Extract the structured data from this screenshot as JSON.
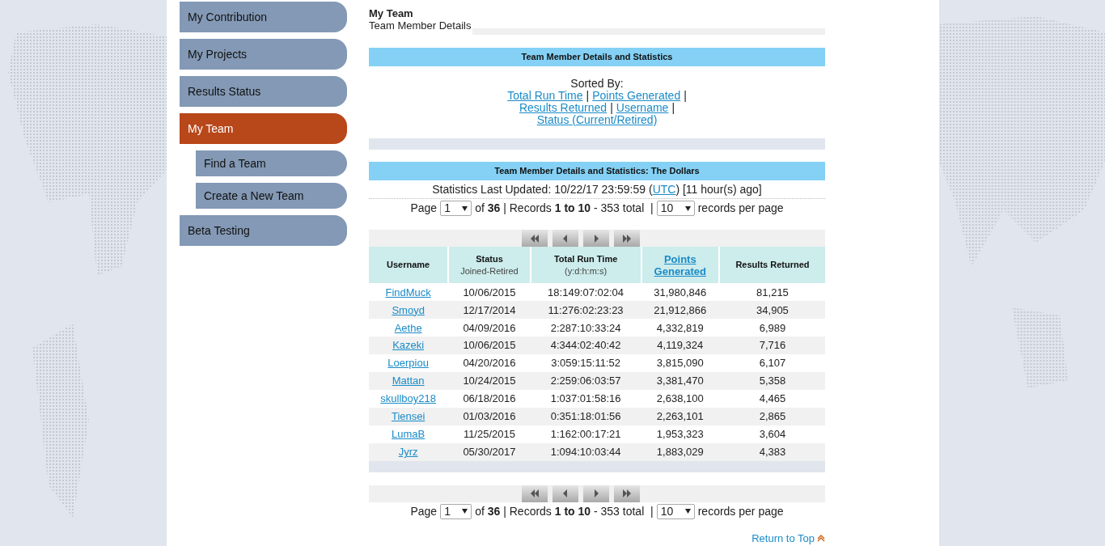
{
  "sidebar": {
    "items": [
      {
        "label": "My Contribution",
        "kind": "main",
        "selected": false
      },
      {
        "label": "My Projects",
        "kind": "main",
        "selected": false
      },
      {
        "label": "Results Status",
        "kind": "main",
        "selected": false
      },
      {
        "label": "My Team",
        "kind": "main",
        "selected": true
      },
      {
        "label": "Find a Team",
        "kind": "sub",
        "selected": false
      },
      {
        "label": "Create a New Team",
        "kind": "sub",
        "selected": false
      },
      {
        "label": "Beta Testing",
        "kind": "main",
        "selected": false
      }
    ]
  },
  "page": {
    "title": "My Team",
    "subtitle": "Team Member Details"
  },
  "sort_panel": {
    "title": "Team Member Details and Statistics",
    "label": "Sorted By:",
    "separator": "|",
    "links": [
      "Total Run Time",
      "Points Generated",
      "Results Returned",
      "Username",
      "Status (Current/Retired)"
    ]
  },
  "stats_panel": {
    "title": "Team Member Details and Statistics: The Dollars",
    "updated_prefix": "Statistics Last Updated: 10/22/17 23:59:59 (",
    "updated_link": "UTC",
    "updated_suffix": ") [11 hour(s) ago]"
  },
  "pagers": [
    {
      "page_label": "Page",
      "page_value": "1",
      "summary": "of **36** | Records **1 to 10** - 353 total  |",
      "per_page_value": "10",
      "per_page_label": "records per page"
    },
    {
      "page_label": "Page",
      "page_value": "1",
      "summary": "of **36** | Records **1 to 10** - 353 total  |",
      "per_page_value": "10",
      "per_page_label": "records per page"
    }
  ],
  "table": {
    "columns": [
      {
        "title": "Username",
        "kind": "link",
        "sortable": false
      },
      {
        "title": "Status",
        "subtitle": "Joined-Retired",
        "kind": "text",
        "sortable": false
      },
      {
        "title": "Total Run Time",
        "subtitle": "(y:d:h:m:s)",
        "kind": "text",
        "sortable": false
      },
      {
        "title": "Points Generated",
        "kind": "text",
        "sortable": true
      },
      {
        "title": "Results Returned",
        "kind": "text",
        "sortable": false
      }
    ],
    "rows": [
      [
        "FindMuck",
        "10/06/2015",
        "18:149:07:02:04",
        "31,980,846",
        "81,215"
      ],
      [
        "Smoyd",
        "12/17/2014",
        "11:276:02:23:23",
        "21,912,866",
        "34,905"
      ],
      [
        "Aethe",
        "04/09/2016",
        "2:287:10:33:24",
        "4,332,819",
        "6,989"
      ],
      [
        "Kazeki",
        "10/06/2015",
        "4:344:02:40:42",
        "4,119,324",
        "7,716"
      ],
      [
        "Loerpiou",
        "04/20/2016",
        "3:059:15:11:52",
        "3,815,090",
        "6,107"
      ],
      [
        "Mattan",
        "10/24/2015",
        "2:259:06:03:57",
        "3,381,470",
        "5,358"
      ],
      [
        "skullboy218",
        "06/18/2016",
        "1:037:01:58:16",
        "2,638,100",
        "4,465"
      ],
      [
        "Tiensei",
        "01/03/2016",
        "0:351:18:01:56",
        "2,263,101",
        "2,865"
      ],
      [
        "LumaB",
        "11/25/2015",
        "1:162:00:17:21",
        "1,953,323",
        "3,604"
      ],
      [
        "Jyrz",
        "05/30/2017",
        "1:094:10:03:44",
        "1,883,029",
        "4,383"
      ]
    ]
  },
  "return_link": "Return to Top"
}
